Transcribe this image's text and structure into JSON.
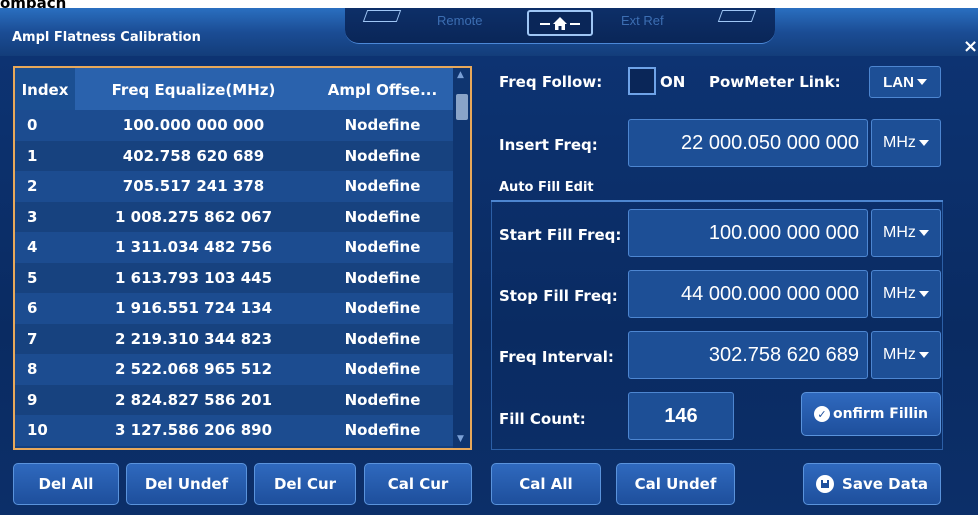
{
  "corner_label": "ompacn",
  "titlebar": {
    "title": "Ampl Flatness Calibration",
    "tab_remote": "Remote",
    "tab_extref": "Ext Ref",
    "close_glyph": "×",
    "home_icon": "home-icon"
  },
  "table": {
    "headers": {
      "index": "Index",
      "freq": "Freq Equalize(MHz)",
      "ampl": "Ampl Offse..."
    },
    "rows": [
      {
        "index": "0",
        "freq": "100.000 000 000",
        "ampl": "Nodefine"
      },
      {
        "index": "1",
        "freq": "402.758 620 689",
        "ampl": "Nodefine"
      },
      {
        "index": "2",
        "freq": "705.517 241 378",
        "ampl": "Nodefine"
      },
      {
        "index": "3",
        "freq": "1 008.275 862 067",
        "ampl": "Nodefine"
      },
      {
        "index": "4",
        "freq": "1 311.034 482 756",
        "ampl": "Nodefine"
      },
      {
        "index": "5",
        "freq": "1 613.793 103 445",
        "ampl": "Nodefine"
      },
      {
        "index": "6",
        "freq": "1 916.551 724 134",
        "ampl": "Nodefine"
      },
      {
        "index": "7",
        "freq": "2 219.310 344 823",
        "ampl": "Nodefine"
      },
      {
        "index": "8",
        "freq": "2 522.068 965 512",
        "ampl": "Nodefine"
      },
      {
        "index": "9",
        "freq": "2 824.827 586 201",
        "ampl": "Nodefine"
      },
      {
        "index": "10",
        "freq": "3 127.586 206 890",
        "ampl": "Nodefine"
      }
    ]
  },
  "settings": {
    "freq_follow_label": "Freq Follow:",
    "freq_follow_on": "ON",
    "powmeter_label": "PowMeter Link:",
    "powmeter_value": "LAN",
    "insert_freq_label": "Insert Freq:",
    "insert_freq_value": "22 000.050 000 000",
    "insert_freq_unit": "MHz"
  },
  "auto_fill": {
    "section_title": "Auto Fill Edit",
    "start_label": "Start Fill Freq:",
    "start_value": "100.000 000 000",
    "start_unit": "MHz",
    "stop_label": "Stop Fill Freq:",
    "stop_value": "44 000.000 000 000",
    "stop_unit": "MHz",
    "interval_label": "Freq Interval:",
    "interval_value": "302.758 620 689",
    "interval_unit": "MHz",
    "count_label": "Fill Count:",
    "count_value": "146",
    "confirm_label": "onfirm Fillin"
  },
  "buttons": {
    "del_all": "Del All",
    "del_undef": "Del Undef",
    "del_cur": "Del Cur",
    "cal_cur": "Cal Cur",
    "cal_all": "Cal All",
    "cal_undef": "Cal Undef",
    "save_data": "Save Data"
  },
  "colors": {
    "panel_bg": "#0a2b62",
    "table_border": "#e8a85a",
    "button_bg": "#2f69be"
  }
}
